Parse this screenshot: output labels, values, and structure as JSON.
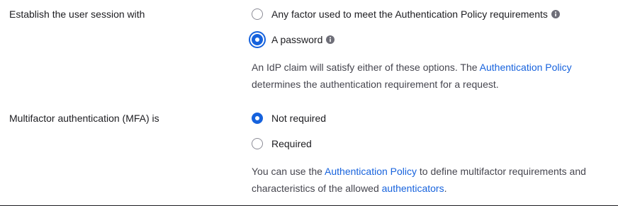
{
  "session": {
    "label": "Establish the user session with",
    "options": [
      {
        "label": "Any factor used to meet the Authentication Policy requirements",
        "checked": false,
        "info_icon": "info-icon"
      },
      {
        "label": "A password",
        "checked": true,
        "info_icon": "info-icon"
      }
    ],
    "help": {
      "text_before": "An IdP claim will satisfy either of these options. The ",
      "link": "Authentication Policy",
      "text_after": " determines the authentication requirement for a request."
    }
  },
  "mfa": {
    "label": "Multifactor authentication (MFA) is",
    "options": [
      {
        "label": "Not required",
        "checked": true
      },
      {
        "label": "Required",
        "checked": false
      }
    ],
    "help": {
      "text_before": "You can use the ",
      "link1": "Authentication Policy",
      "text_middle": " to define multifactor requirements and characteristics of the allowed ",
      "link2": "authenticators",
      "text_after": "."
    }
  },
  "colors": {
    "accent": "#1662dd",
    "text": "#1d1d21",
    "muted_text": "#46464f",
    "radio_border": "#8c8c96"
  }
}
